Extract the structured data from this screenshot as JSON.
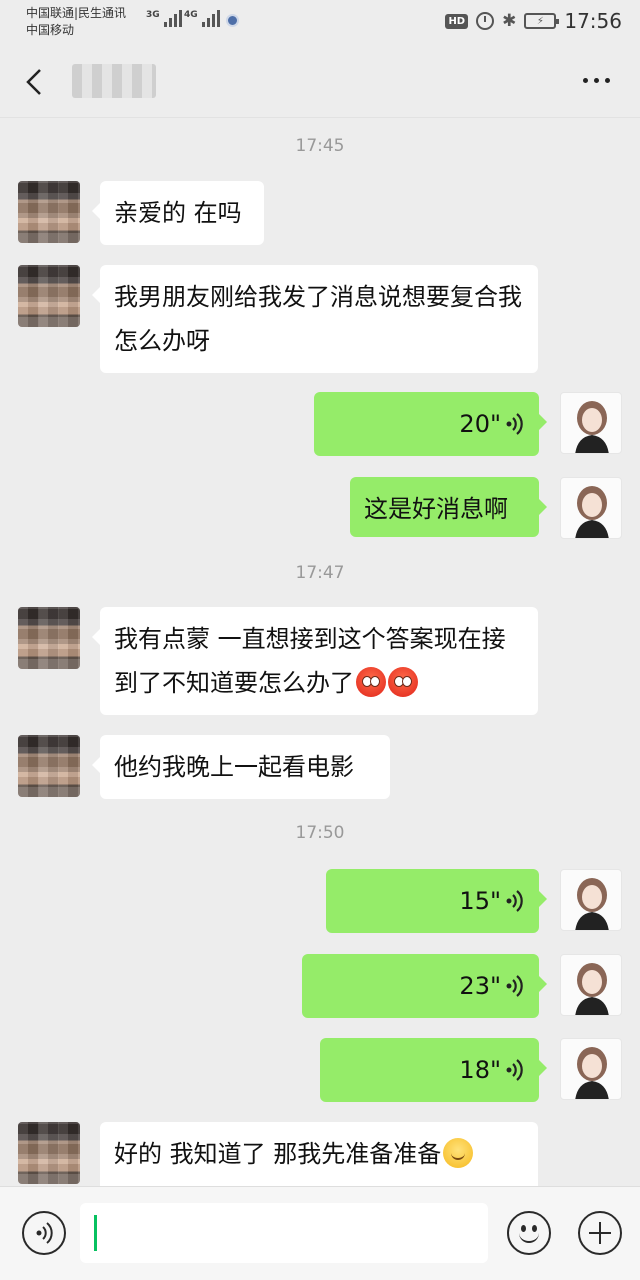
{
  "status_bar": {
    "carrier_1": "中国联通|民生通讯",
    "carrier_2": "中国移动",
    "network_1": "3G",
    "network_2": "4G",
    "hd_label": "HD",
    "time": "17:56"
  },
  "header": {
    "title": "",
    "back_icon": "chevron-left-icon",
    "more_icon": "more-dots-icon"
  },
  "messages": {
    "ts_1": "17:45",
    "m1": "亲爱的 在吗",
    "m2": "我男朋友刚给我发了消息说想要复合我怎么办呀",
    "v1": "20\"",
    "m3": "这是好消息啊",
    "ts_2": "17:47",
    "m4": "我有点蒙 一直想接到这个答案现在接到了不知道要怎么办了",
    "m5": "他约我晚上一起看电影",
    "ts_3": "17:50",
    "v2": "15\"",
    "v3": "23\"",
    "v4": "18\"",
    "m6": "好的  我知道了  那我先准备准备"
  },
  "input_bar": {
    "value": "",
    "voice_icon": "voice-input-icon",
    "emoji_icon": "emoji-icon",
    "plus_icon": "plus-icon"
  },
  "colors": {
    "outgoing_bubble": "#95ec69",
    "incoming_bubble": "#ffffff",
    "background": "#ededed",
    "caret": "#07c160"
  }
}
